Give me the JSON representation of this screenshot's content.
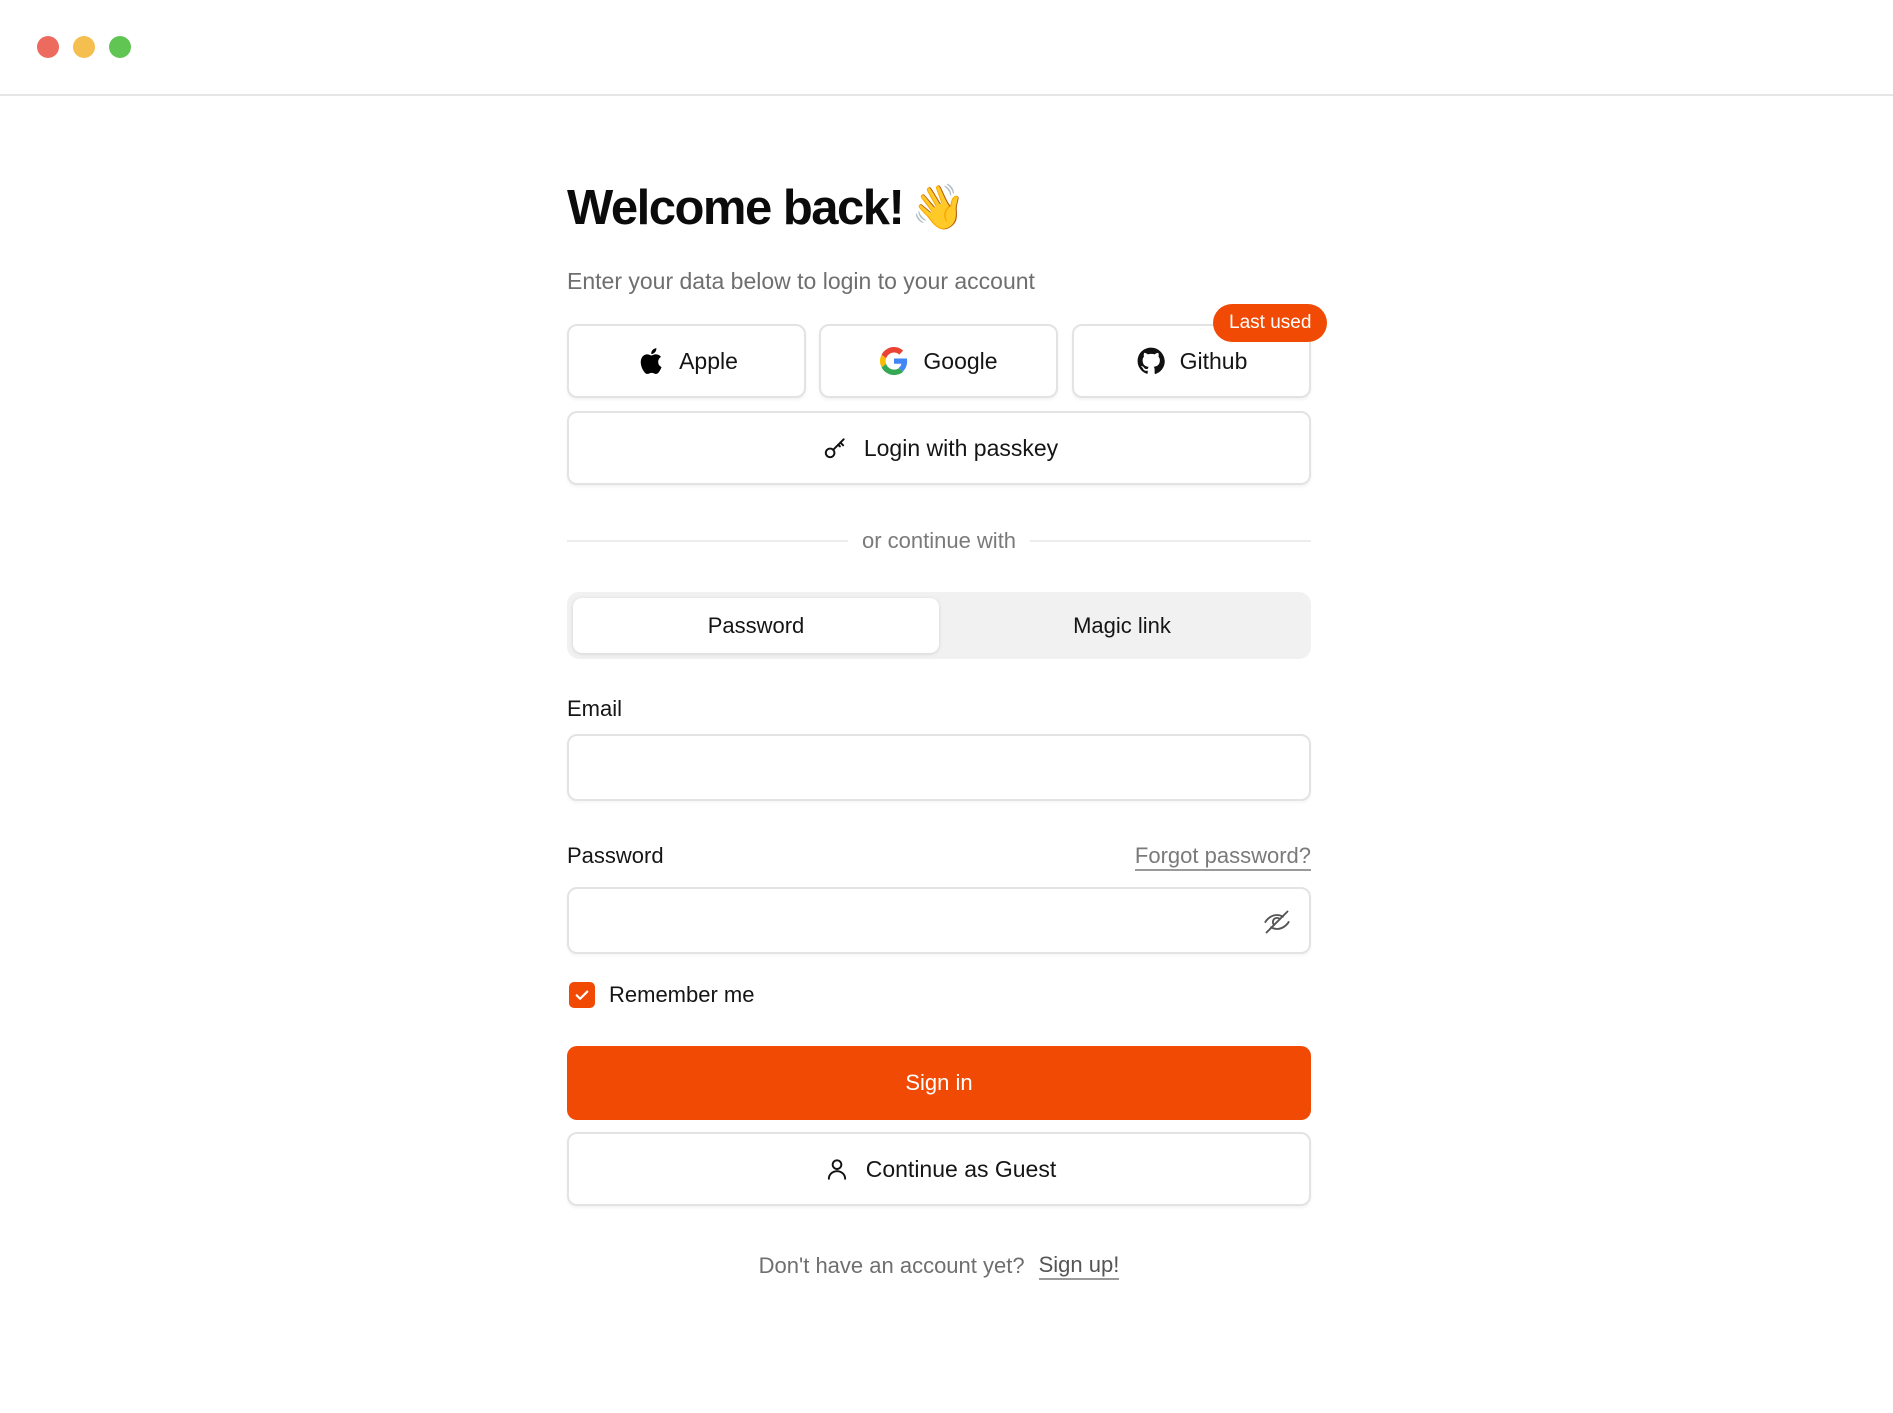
{
  "window": {
    "traffic_lights": [
      "#ec6a5e",
      "#f4bf4f",
      "#61c554"
    ]
  },
  "header": {
    "title": "Welcome back!",
    "emoji": "👋",
    "subtitle": "Enter your data below to login to your account"
  },
  "social": {
    "apple": {
      "label": "Apple",
      "icon": "apple-icon"
    },
    "google": {
      "label": "Google",
      "icon": "google-icon"
    },
    "github": {
      "label": "Github",
      "icon": "github-icon",
      "badge": "Last used"
    }
  },
  "passkey": {
    "label": "Login with passkey",
    "icon": "key-icon"
  },
  "divider": {
    "text": "or continue with"
  },
  "tabs": [
    {
      "label": "Password",
      "active": true
    },
    {
      "label": "Magic link",
      "active": false
    }
  ],
  "form": {
    "email_label": "Email",
    "email_value": "",
    "password_label": "Password",
    "password_value": "",
    "forgot_label": "Forgot password?",
    "password_toggle_icon": "eye-off-icon",
    "remember_label": "Remember me",
    "remember_checked": true
  },
  "actions": {
    "signin_label": "Sign in",
    "guest_label": "Continue as Guest",
    "guest_icon": "user-icon"
  },
  "footer": {
    "question": "Don't have an account yet?",
    "signup_label": "Sign up!"
  },
  "colors": {
    "accent": "#f14a05",
    "border": "#e3e3e3",
    "muted_text": "#6f6f6f"
  }
}
